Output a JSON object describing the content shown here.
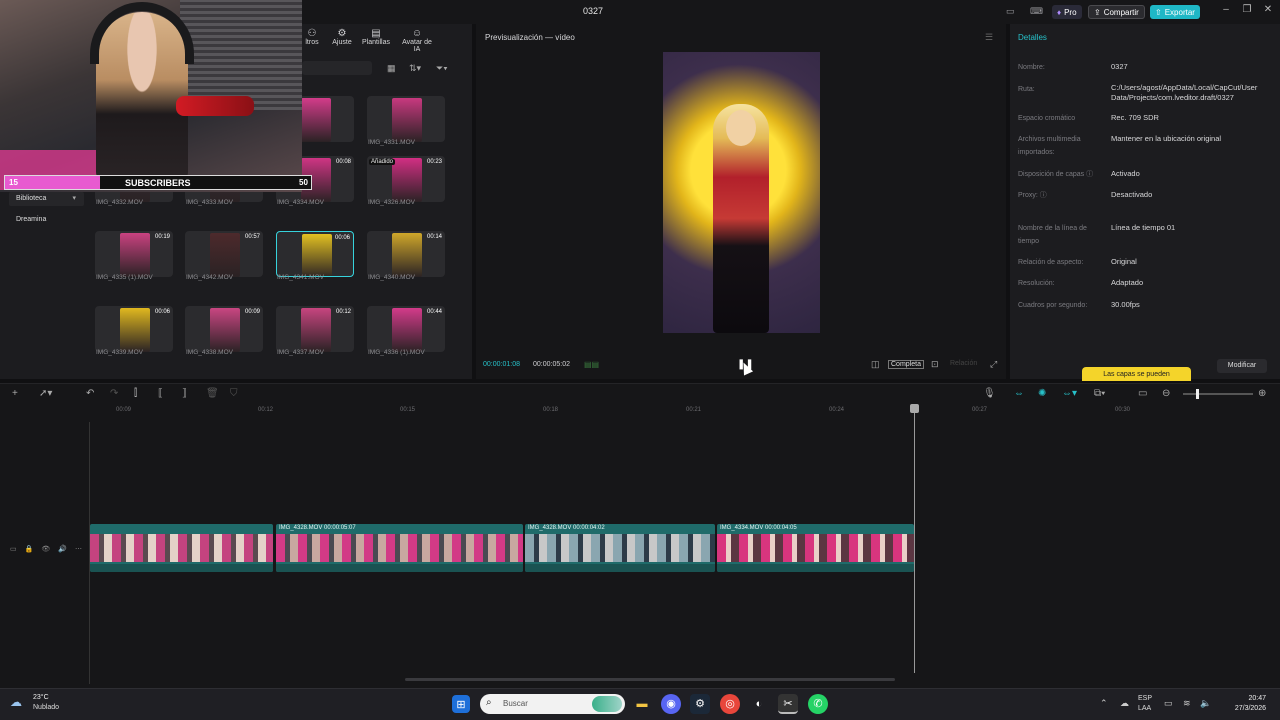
{
  "window": {
    "title": "0327",
    "pro_label": "Pro",
    "share_label": "Compartir",
    "export_label": "Exportar"
  },
  "webcam_overlay": {
    "subscribers_label": "SUBSCRIBERS",
    "count_current": "15",
    "count_goal": "50",
    "progress": 0.31
  },
  "media_toolbar": {
    "items": [
      {
        "label": "ltros",
        "icon": "filter-icon"
      },
      {
        "label": "Ajuste",
        "icon": "adjust-icon"
      },
      {
        "label": "Plantillas",
        "icon": "templates-icon"
      },
      {
        "label": "Avatar de IA",
        "icon": "ai-avatar-icon"
      }
    ]
  },
  "left_nav": {
    "library": "Biblioteca",
    "dreamina": "Dreamina"
  },
  "media_items": [
    {
      "name": "30.MOV",
      "duration": "",
      "added": false,
      "color": "#d33c8a"
    },
    {
      "name": "IMG_4331.MOV",
      "duration": "",
      "added": false,
      "color": "#c8397f"
    },
    {
      "name": "IMG_4332.MOV",
      "duration": "",
      "added": false,
      "color": "#3a3038"
    },
    {
      "name": "IMG_4333.MOV",
      "duration": "",
      "added": false,
      "color": "#3a3038"
    },
    {
      "name": "IMG_4334.MOV",
      "duration": "00:08",
      "added": false,
      "color": "#cf3584"
    },
    {
      "name": "IMG_4326.MOV",
      "duration": "00:23",
      "added": true,
      "added_label": "Añadido",
      "color": "#d22f83"
    },
    {
      "name": "IMG_4335 (1).MOV",
      "duration": "00:19",
      "added": false,
      "color": "#c94280"
    },
    {
      "name": "IMG_4342.MOV",
      "duration": "00:57",
      "added": false,
      "color": "#4d2a2c"
    },
    {
      "name": "IMG_4341.MOV",
      "duration": "00:06",
      "added": false,
      "selected": true,
      "color": "#e2c021"
    },
    {
      "name": "IMG_4340.MOV",
      "duration": "00:14",
      "added": false,
      "color": "#cfa72a"
    },
    {
      "name": "IMG_4339.MOV",
      "duration": "00:06",
      "added": false,
      "color": "#e0b81f"
    },
    {
      "name": "IMG_4338.MOV",
      "duration": "00:09",
      "added": false,
      "color": "#c94682"
    },
    {
      "name": "IMG_4337.MOV",
      "duration": "00:12",
      "added": false,
      "color": "#c7457f"
    },
    {
      "name": "IMG_4336 (1).MOV",
      "duration": "00:44",
      "added": false,
      "color": "#d33b8a"
    }
  ],
  "preview": {
    "title": "Previsualización — vídeo",
    "current_time": "00:00:01:08",
    "total_time": "00:00:05:02",
    "fit_label": "Completa",
    "ratio_label": "Relación"
  },
  "details": {
    "title": "Detalles",
    "fields": [
      {
        "label": "Nombre:",
        "value": "0327"
      },
      {
        "label": "Ruta:",
        "value": "C:/Users/agost/AppData/Local/CapCut/User Data/Projects/com.lveditor.draft/0327"
      },
      {
        "label": "Espacio cromático",
        "value": "Rec. 709 SDR"
      },
      {
        "label": "Archivos multimedia importados:",
        "value": "Mantener en la ubicación original"
      },
      {
        "label": "Disposición de capas ⓘ",
        "value": "Activado"
      },
      {
        "label": "Proxy: ⓘ",
        "value": "Desactivado"
      },
      {
        "label": "Nombre de la línea de tiempo",
        "value": "Línea de tiempo 01"
      },
      {
        "label": "Relación de aspecto:",
        "value": "Original"
      },
      {
        "label": "Resolución:",
        "value": "Adaptado"
      },
      {
        "label": "Cuadros por segundo:",
        "value": "30.00fps"
      }
    ],
    "tooltip": "Las capas se pueden",
    "modify_label": "Modificar"
  },
  "timeline": {
    "ticks": [
      "00:09",
      "00:12",
      "00:15",
      "00:18",
      "00:21",
      "00:24",
      "00:27",
      "00:30"
    ],
    "clips": [
      {
        "label": "",
        "colors": [
          "#c4437f",
          "#5a4a50",
          "#e4d2c8"
        ]
      },
      {
        "label": "IMG_4328.MOV  00:00:05:07",
        "colors": [
          "#d23a86",
          "#4a4a52",
          "#c8a8a0"
        ]
      },
      {
        "label": "IMG_4328.MOV  00:00:04:02",
        "colors": [
          "#8aa6b0",
          "#2d3b48",
          "#c8c8c8"
        ]
      },
      {
        "label": "IMG_4334.MOV  00:00:04:05",
        "colors": [
          "#d8357e",
          "#e9d0c8",
          "#5b3642"
        ]
      }
    ]
  },
  "taskbar": {
    "temperature": "23°C",
    "weather": "Nublado",
    "search_placeholder": "Buscar",
    "lang_top": "ESP",
    "lang_bottom": "LAA",
    "time": "20:47",
    "date": "27/3/2026"
  }
}
